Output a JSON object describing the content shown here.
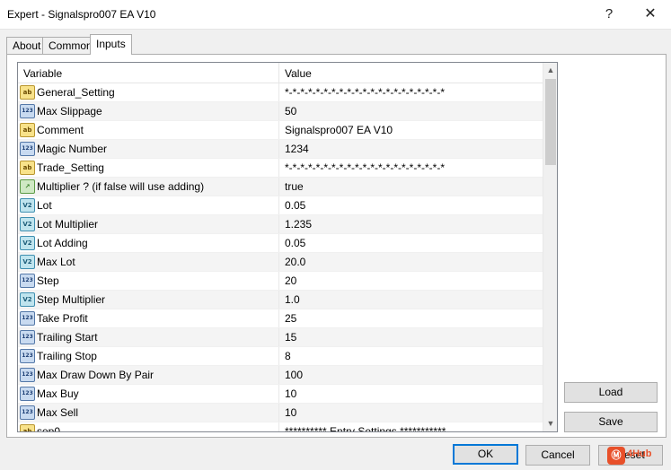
{
  "window": {
    "title": "Expert - Signalspro007 EA V10",
    "help_label": "?",
    "close_label": "✕"
  },
  "tabs": [
    {
      "label": "About"
    },
    {
      "label": "Common"
    },
    {
      "label": "Inputs",
      "active": true
    }
  ],
  "grid": {
    "columns": [
      "Variable",
      "Value"
    ],
    "rows": [
      {
        "icon": "ab",
        "name": "General_Setting",
        "value": "*-*-*-*-*-*-*-*-*-*-*-*-*-*-*-*-*-*-*-*-*"
      },
      {
        "icon": "123",
        "name": "Max Slippage",
        "value": "50"
      },
      {
        "icon": "ab",
        "name": "Comment",
        "value": "Signalspro007 EA V10"
      },
      {
        "icon": "123",
        "name": "Magic Number",
        "value": "1234"
      },
      {
        "icon": "ab",
        "name": "Trade_Setting",
        "value": "*-*-*-*-*-*-*-*-*-*-*-*-*-*-*-*-*-*-*-*-*"
      },
      {
        "icon": "bool",
        "name": "Multiplier ? (if false will use adding)",
        "value": "true"
      },
      {
        "icon": "v2",
        "name": "Lot",
        "value": "0.05"
      },
      {
        "icon": "v2",
        "name": "Lot Multiplier",
        "value": "1.235"
      },
      {
        "icon": "v2",
        "name": "Lot Adding",
        "value": "0.05"
      },
      {
        "icon": "v2",
        "name": "Max Lot",
        "value": "20.0"
      },
      {
        "icon": "123",
        "name": "Step",
        "value": "20"
      },
      {
        "icon": "v2",
        "name": "Step Multiplier",
        "value": "1.0"
      },
      {
        "icon": "123",
        "name": "Take Profit",
        "value": "25"
      },
      {
        "icon": "123",
        "name": "Trailing Start",
        "value": "15"
      },
      {
        "icon": "123",
        "name": "Trailing Stop",
        "value": "8"
      },
      {
        "icon": "123",
        "name": "Max Draw Down By Pair",
        "value": "100"
      },
      {
        "icon": "123",
        "name": "Max Buy",
        "value": "10"
      },
      {
        "icon": "123",
        "name": "Max Sell",
        "value": "10"
      },
      {
        "icon": "ab",
        "name": "sep0",
        "value": "********** Entry Settings ***********"
      }
    ]
  },
  "icon_labels": {
    "ab": "ab",
    "123": "123",
    "v2": "V2",
    "bool": "↗"
  },
  "side_buttons": {
    "load": "Load",
    "save": "Save"
  },
  "footer": {
    "ok": "OK",
    "cancel": "Cancel",
    "reset": "Reset"
  },
  "watermark": {
    "badge": "Ⓜ",
    "text": "4Hub"
  },
  "scrollbar": {
    "up_icon": "▲",
    "down_icon": "▼"
  }
}
